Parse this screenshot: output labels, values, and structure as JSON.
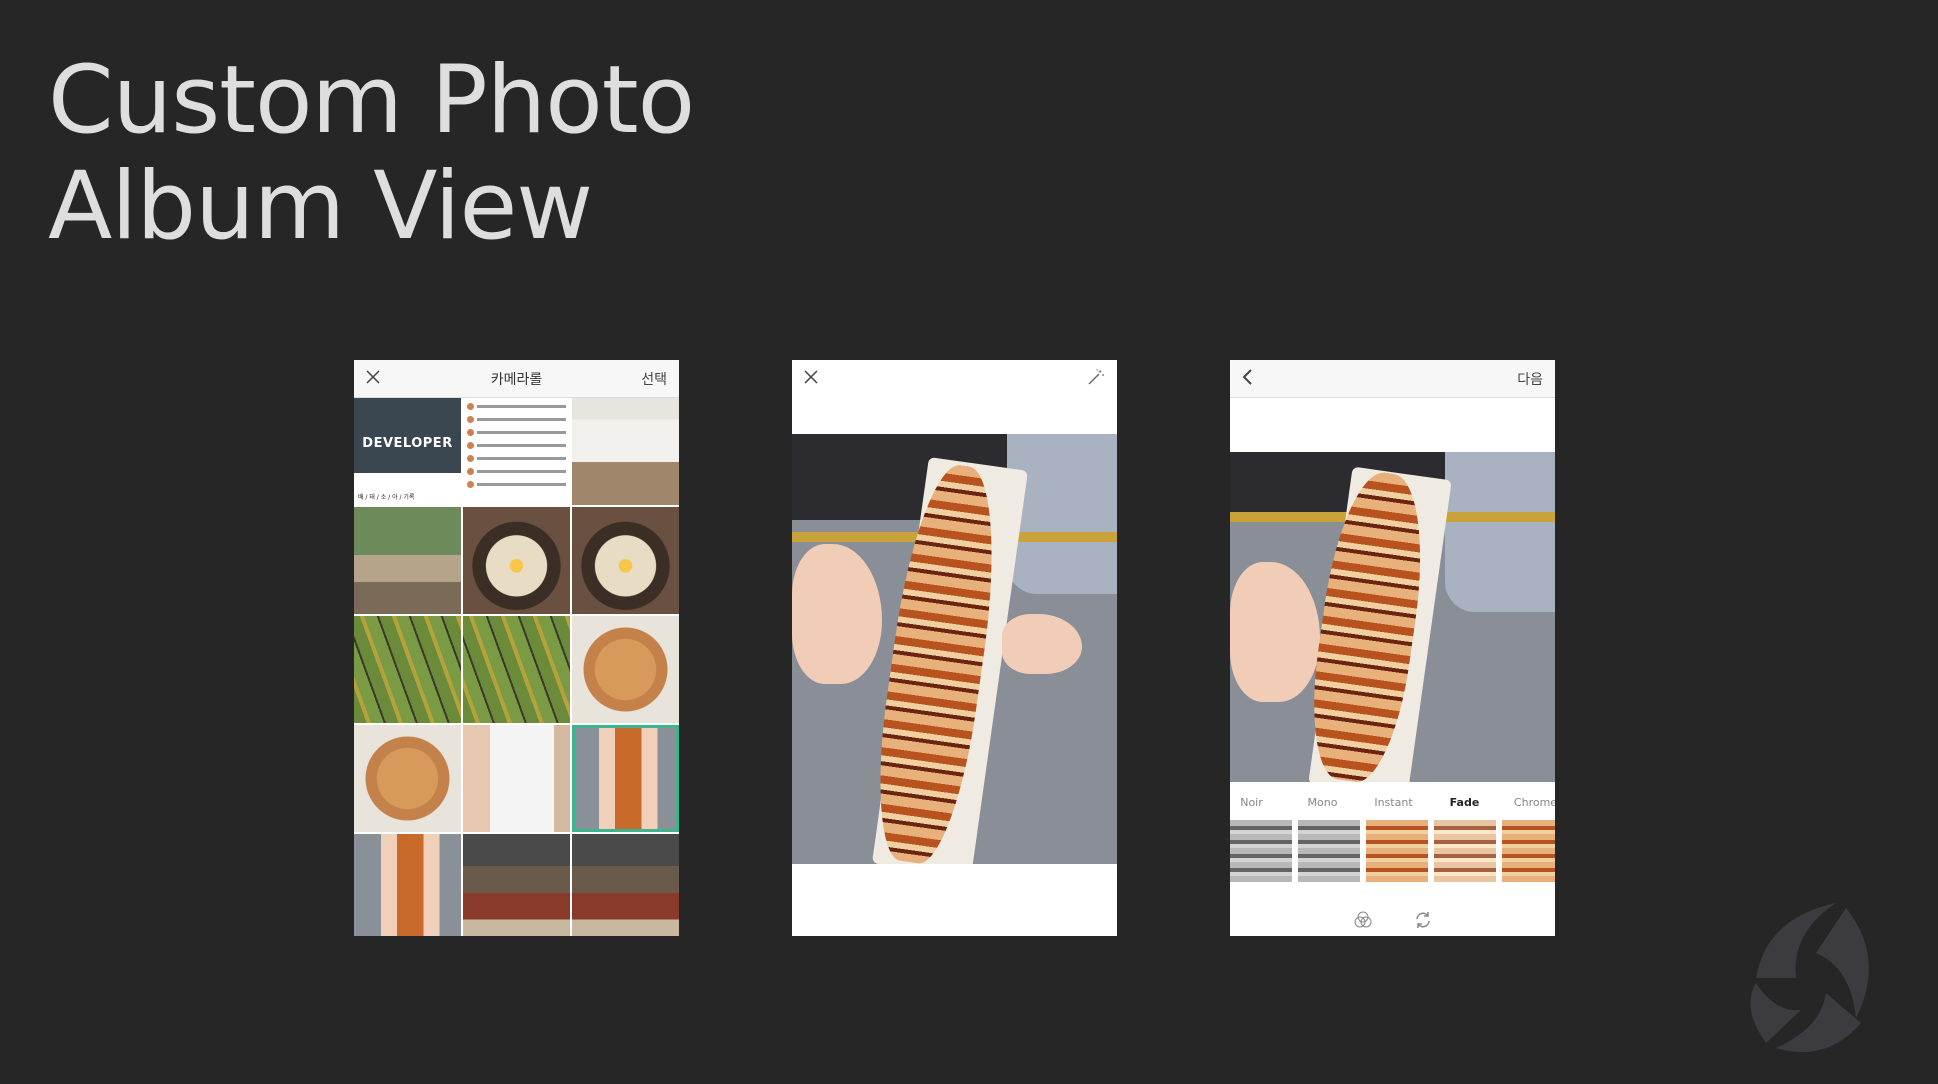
{
  "slide": {
    "title_line1": "Custom Photo",
    "title_line2": "Album View"
  },
  "screen1": {
    "navbar": {
      "title": "카메라롤",
      "right_label": "선택",
      "left_icon": "close-icon"
    },
    "grid": [
      {
        "type": "dev",
        "label": "DEVELOPER",
        "sub": "배 / 태 / 소 / 아 / 기록"
      },
      {
        "type": "list"
      },
      {
        "type": "room"
      },
      {
        "type": "couple"
      },
      {
        "type": "soup"
      },
      {
        "type": "soup"
      },
      {
        "type": "green"
      },
      {
        "type": "green"
      },
      {
        "type": "taiyaki"
      },
      {
        "type": "taiyaki"
      },
      {
        "type": "bag"
      },
      {
        "type": "food",
        "selected": true
      },
      {
        "type": "food"
      },
      {
        "type": "house"
      },
      {
        "type": "house"
      }
    ]
  },
  "screen2": {
    "navbar": {
      "left_icon": "close-icon",
      "right_icon": "magic-wand-icon"
    }
  },
  "screen3": {
    "navbar": {
      "left_icon": "back-chevron-icon",
      "right_label": "다음"
    },
    "filters": [
      {
        "label": "Noir",
        "style": "gray"
      },
      {
        "label": "Mono",
        "style": "gray"
      },
      {
        "label": "Instant",
        "style": "normal"
      },
      {
        "label": "Fade",
        "style": "fade",
        "active": true
      },
      {
        "label": "Chrome",
        "style": "normal"
      }
    ],
    "bottom_icons": [
      "filter-circles-icon",
      "rotate-icon"
    ]
  },
  "colors": {
    "background": "#262626",
    "title": "#dedede",
    "selected_outline": "#3cb48c"
  }
}
